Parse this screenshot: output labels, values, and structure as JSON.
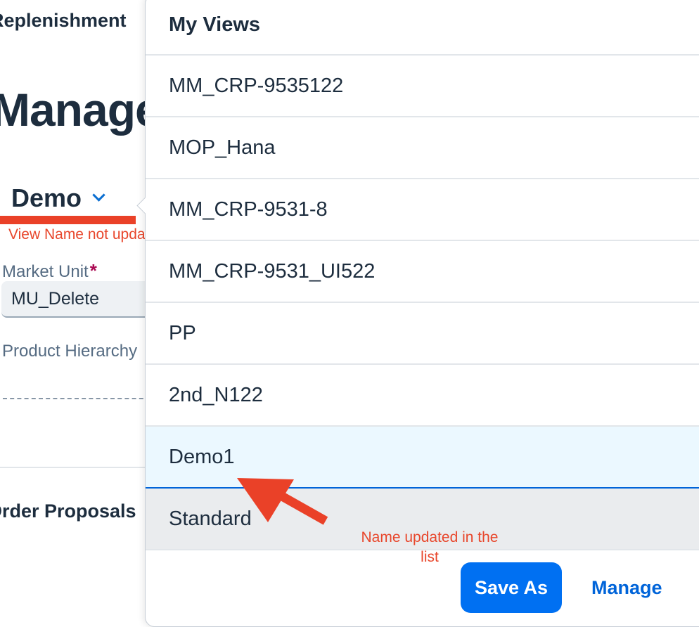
{
  "background": {
    "app_title": "Replenishment",
    "page_title": "Manage",
    "variant": {
      "name": "Demo",
      "icon": "chevron-down-icon"
    },
    "filters": [
      {
        "label": "Market Unit",
        "required": true,
        "value": "MU_Delete"
      },
      {
        "label": "Product Hierarchy"
      }
    ],
    "section_title": "Order Proposals"
  },
  "popover": {
    "title": "My Views",
    "items": [
      "MM_CRP-9535122",
      "MOP_Hana",
      "MM_CRP-9531-8",
      "MM_CRP-9531_UI522",
      "PP",
      "2nd_N122",
      "Demo1",
      "Standard"
    ],
    "selected_item": "Demo1",
    "buttons": {
      "save_as": "Save As",
      "manage": "Manage"
    }
  },
  "annotations": {
    "view_name_note": "View Name not updated",
    "list_note": "Name updated in the list"
  },
  "colors": {
    "accent": "#0070f2",
    "link": "#0064d9",
    "annotation": "#ea4128",
    "selected_bg": "#ebf8ff",
    "required": "#aa0b53"
  }
}
